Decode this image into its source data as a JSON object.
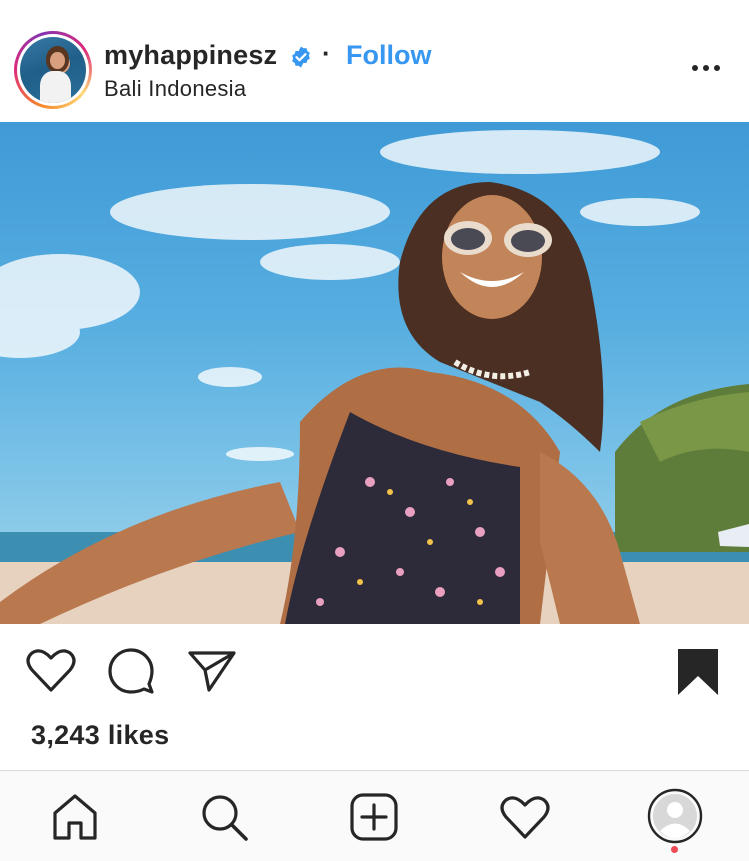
{
  "post": {
    "username": "myhappinesz",
    "verified": true,
    "separator": "·",
    "follow_label": "Follow",
    "location": "Bali Indonesia",
    "likes_text": "3,243 likes"
  },
  "icons": {
    "header_more": "more-options-icon",
    "like": "heart-icon",
    "comment": "comment-bubble-icon",
    "share": "paper-plane-icon",
    "save": "bookmark-filled-icon",
    "verified": "verified-badge-icon"
  },
  "tabbar": {
    "items": [
      "home-icon",
      "search-icon",
      "new-post-icon",
      "activity-heart-icon",
      "profile-avatar"
    ],
    "notification_dot": true
  },
  "colors": {
    "follow_blue": "#3897f0",
    "verified_blue": "#3897f0",
    "text": "#262626",
    "notification_red": "#ed4956"
  }
}
